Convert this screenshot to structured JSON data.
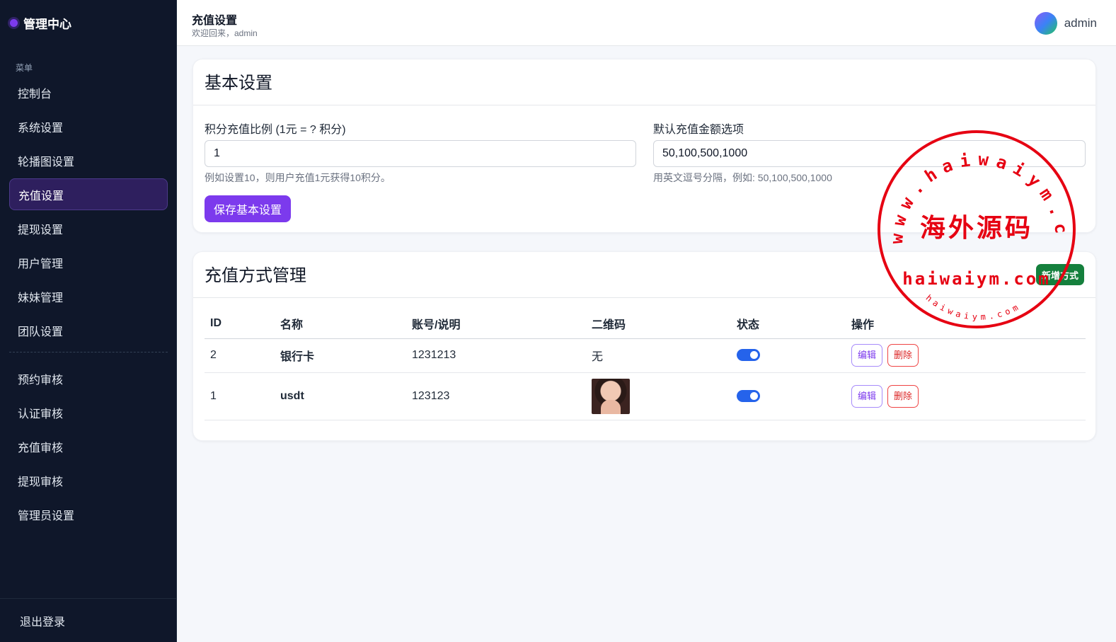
{
  "sidebar": {
    "brand": "管理中心",
    "section_label": "菜单",
    "items_top": [
      "控制台",
      "系统设置",
      "轮播图设置",
      "充值设置",
      "提现设置",
      "用户管理",
      "妹妹管理",
      "团队设置"
    ],
    "items_bottom": [
      "预约审核",
      "认证审核",
      "充值审核",
      "提现审核",
      "管理员设置"
    ],
    "active": "充值设置",
    "logout": "退出登录"
  },
  "header": {
    "title": "充值设置",
    "subtitle": "欢迎回来，admin",
    "username": "admin"
  },
  "basic": {
    "title": "基本设置",
    "ratio_label": "积分充值比例 (1元 = ? 积分)",
    "ratio_value": "1",
    "ratio_help": "例如设置10，则用户充值1元获得10积分。",
    "amounts_label": "默认充值金额选项",
    "amounts_value": "50,100,500,1000",
    "amounts_help": "用英文逗号分隔，例如: 50,100,500,1000",
    "save_button": "保存基本设置"
  },
  "methods": {
    "title": "充值方式管理",
    "add_button": "新增方式",
    "columns": [
      "ID",
      "名称",
      "账号/说明",
      "二维码",
      "状态",
      "操作"
    ],
    "rows": [
      {
        "id": "2",
        "name": "银行卡",
        "account": "1231213",
        "qrcode": "无",
        "enabled": true
      },
      {
        "id": "1",
        "name": "usdt",
        "account": "123123",
        "qrcode": "",
        "enabled": true
      }
    ],
    "edit_label": "编辑",
    "delete_label": "删除"
  },
  "watermark": {
    "ring_text": "www.haiwaiym.com",
    "center_text": "海外源码",
    "domain_text": "haiwaiym.com",
    "bottom_text": "haiwaiym.com",
    "color": "#e60012"
  },
  "colors": {
    "sidebar_bg": "#0f172a",
    "accent": "#7c3aed",
    "success": "#15803d",
    "toggle_on": "#2563eb",
    "danger": "#dc2626"
  }
}
